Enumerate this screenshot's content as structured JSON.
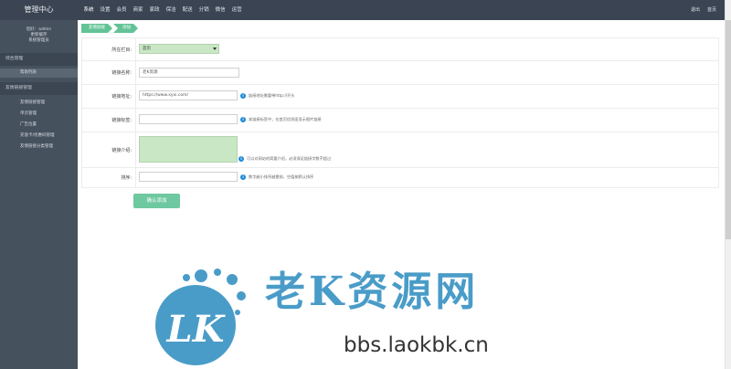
{
  "app": {
    "title": "管理中心"
  },
  "topnav": [
    "系统",
    "设置",
    "会员",
    "商家",
    "家政",
    "保洁",
    "配送",
    "分销",
    "微信",
    "运营"
  ],
  "topright": [
    "退出",
    "首页"
  ],
  "user": {
    "line1": "您好：admin",
    "line2": "更新缓存",
    "line3": "系统管理员"
  },
  "sidebar": {
    "section1": "综合管理",
    "section1_items": [
      "帮助列表"
    ],
    "section2": "友情链接管理",
    "section2_items": [
      "友情链接管理",
      "单页管理",
      "广告位置",
      "充值卡/优惠码管理",
      "友情链接分类管理"
    ]
  },
  "breadcrumb": [
    "友情链接",
    "添加"
  ],
  "form": {
    "category_label": "所在栏目:",
    "category_value": "首页",
    "name_label": "链接名称:",
    "name_value": "老K资源",
    "url_label": "链接地址:",
    "url_value": "https://www.xyxi.com/",
    "url_hint": "链接地址需要带http://开头",
    "logo_label": "链接标签:",
    "logo_value": "",
    "logo_hint": "本链接标签中，在首页优质面显示图片链接",
    "desc_label": "链接介绍:",
    "desc_hint": "可以对网站的简要介绍，必须保证链接字数不超过",
    "order_label": "排序:",
    "order_value": "",
    "order_hint": "数字越小排序越靠前，空值按默认排序"
  },
  "submit_label": "确认添加",
  "watermark": {
    "logo_text": "LK",
    "title": "老K资源网",
    "url": "bbs.laokbk.cn"
  },
  "colors": {
    "topbar": "#3a4452",
    "sidebar": "#46515e",
    "accent": "#62c396",
    "watermark": "#4a9cc8"
  }
}
